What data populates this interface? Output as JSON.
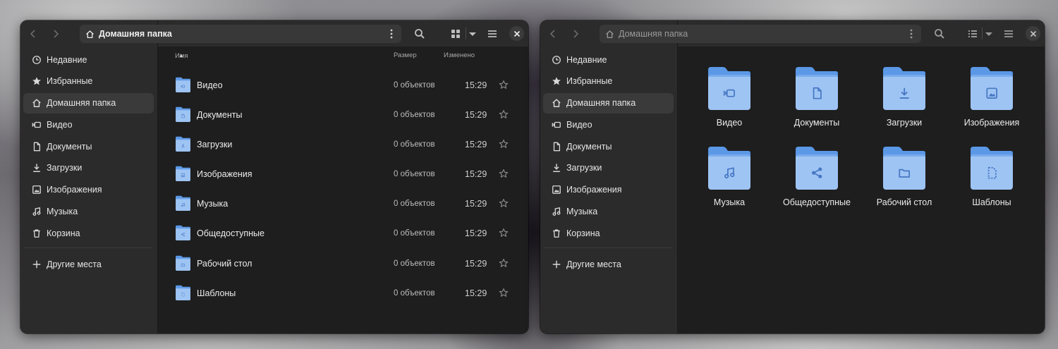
{
  "accent": "#4f8ee3",
  "folder_light": "#9ec4f4",
  "folder_dark": "#5b98e6",
  "left_window": {
    "title": "Домашняя папка",
    "view_mode": "list",
    "columns": {
      "name": "Имя",
      "size": "Размер",
      "modified": "Изменено"
    },
    "rows": [
      {
        "name": "Видео",
        "size": "0 объектов",
        "time": "15:29",
        "icon": "video-icon"
      },
      {
        "name": "Документы",
        "size": "0 объектов",
        "time": "15:29",
        "icon": "document-icon"
      },
      {
        "name": "Загрузки",
        "size": "0 объектов",
        "time": "15:29",
        "icon": "download-icon"
      },
      {
        "name": "Изображения",
        "size": "0 объектов",
        "time": "15:29",
        "icon": "image-icon"
      },
      {
        "name": "Музыка",
        "size": "0 объектов",
        "time": "15:29",
        "icon": "music-icon"
      },
      {
        "name": "Общедоступные",
        "size": "0 объектов",
        "time": "15:29",
        "icon": "share-icon"
      },
      {
        "name": "Рабочий стол",
        "size": "0 объектов",
        "time": "15:29",
        "icon": "desktop-icon"
      },
      {
        "name": "Шаблоны",
        "size": "0 объектов",
        "time": "15:29",
        "icon": "template-icon"
      }
    ]
  },
  "right_window": {
    "title": "Домашняя папка",
    "view_mode": "grid",
    "tiles": [
      {
        "name": "Видео",
        "icon": "video-icon"
      },
      {
        "name": "Документы",
        "icon": "document-icon"
      },
      {
        "name": "Загрузки",
        "icon": "download-icon"
      },
      {
        "name": "Изображения",
        "icon": "image-icon"
      },
      {
        "name": "Музыка",
        "icon": "music-icon"
      },
      {
        "name": "Общедоступные",
        "icon": "share-icon"
      },
      {
        "name": "Рабочий стол",
        "icon": "desktop-icon"
      },
      {
        "name": "Шаблоны",
        "icon": "template-icon"
      }
    ]
  },
  "sidebar": {
    "items": [
      {
        "label": "Недавние",
        "icon": "clock-icon"
      },
      {
        "label": "Избранные",
        "icon": "star-icon"
      },
      {
        "label": "Домашняя папка",
        "icon": "home-icon",
        "active": true
      },
      {
        "label": "Видео",
        "icon": "video-icon"
      },
      {
        "label": "Документы",
        "icon": "document-icon"
      },
      {
        "label": "Загрузки",
        "icon": "download-icon"
      },
      {
        "label": "Изображения",
        "icon": "image-icon"
      },
      {
        "label": "Музыка",
        "icon": "music-icon"
      },
      {
        "label": "Корзина",
        "icon": "trash-icon"
      }
    ],
    "other_places": "Другие места"
  }
}
